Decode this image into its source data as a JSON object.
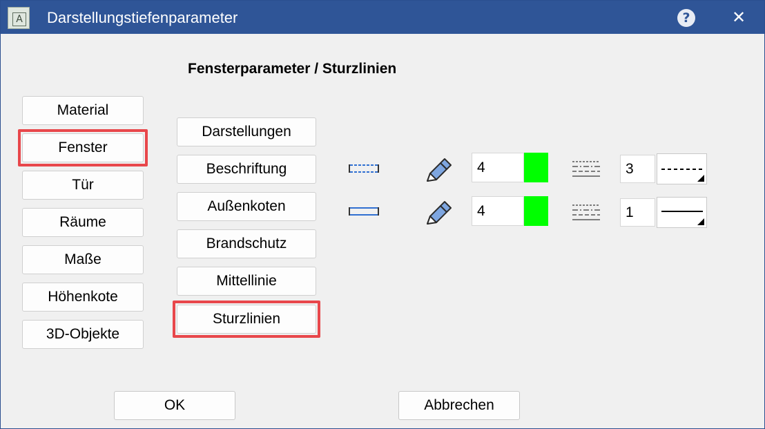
{
  "window": {
    "title": "Darstellungstiefenparameter"
  },
  "titlebar": {
    "app_icon": "app-logo-icon",
    "app_icon_letter": "A",
    "help_icon": "help-icon",
    "help_symbol": "?",
    "close_icon": "close-icon",
    "close_symbol": "✕"
  },
  "heading": "Fensterparameter / Sturzlinien",
  "categories": [
    {
      "label": "Material",
      "selected": false
    },
    {
      "label": "Fenster",
      "selected": true
    },
    {
      "label": "Tür",
      "selected": false
    },
    {
      "label": "Räume",
      "selected": false
    },
    {
      "label": "Maße",
      "selected": false
    },
    {
      "label": "Höhenkote",
      "selected": false
    },
    {
      "label": "3D-Objekte",
      "selected": false
    }
  ],
  "subcategories": [
    {
      "label": "Darstellungen",
      "selected": false
    },
    {
      "label": "Beschriftung",
      "selected": false
    },
    {
      "label": "Außenkoten",
      "selected": false
    },
    {
      "label": "Brandschutz",
      "selected": false
    },
    {
      "label": "Mittellinie",
      "selected": false
    },
    {
      "label": "Sturzlinien",
      "selected": true
    }
  ],
  "params": [
    {
      "line_icon": "dashed-lintel-line-icon",
      "pen_icon": "pen-icon",
      "pen_value": "4",
      "color": "#00ff00",
      "linetype_icon": "linetype-icon",
      "linetype_value": "3",
      "linetype_style": "dashed"
    },
    {
      "line_icon": "solid-lintel-line-icon",
      "pen_icon": "pen-icon",
      "pen_value": "4",
      "color": "#00ff00",
      "linetype_icon": "linetype-icon",
      "linetype_value": "1",
      "linetype_style": "solid"
    }
  ],
  "footer": {
    "ok_label": "OK",
    "cancel_label": "Abbrechen"
  },
  "colors": {
    "titlebar": "#2f5597",
    "highlight": "#e8474b",
    "background": "#f0f0f0"
  }
}
